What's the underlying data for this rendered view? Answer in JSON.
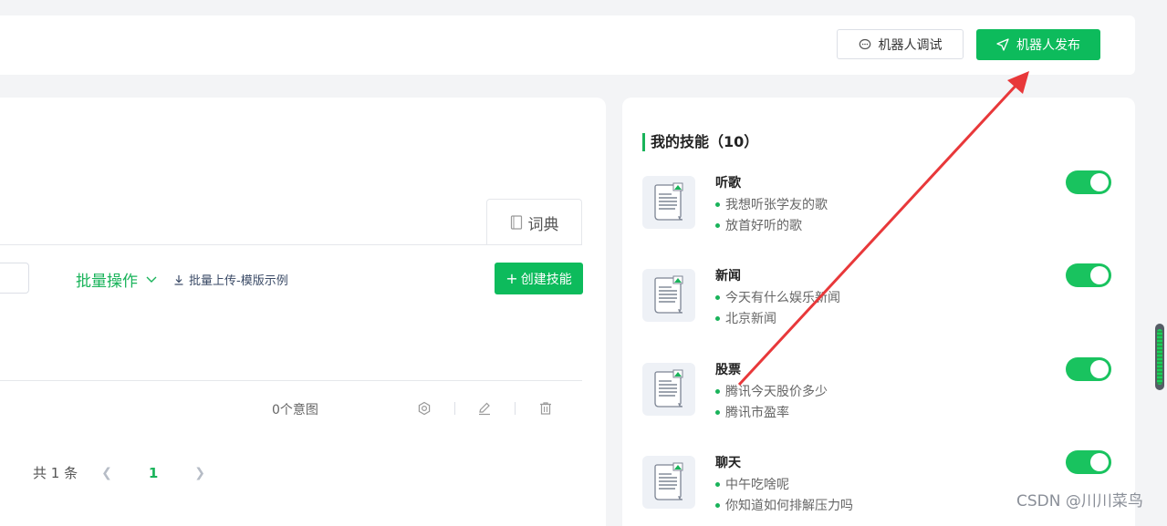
{
  "header": {
    "debug_button": "机器人调试",
    "publish_button": "机器人发布"
  },
  "workspace": {
    "dict_tab": "词典",
    "batch_operation": "批量操作",
    "batch_upload": "批量上传-模版示例",
    "create_skill": "创建技能",
    "intent_count": "0个意图",
    "pagination": {
      "total_label": "共 1 条",
      "current_page": "1"
    }
  },
  "skills": {
    "title": "我的技能（10）",
    "items": [
      {
        "name": "听歌",
        "examples": [
          "我想听张学友的歌",
          "放首好听的歌"
        ],
        "enabled": true
      },
      {
        "name": "新闻",
        "examples": [
          "今天有什么娱乐新闻",
          "北京新闻"
        ],
        "enabled": true
      },
      {
        "name": "股票",
        "examples": [
          "腾讯今天股价多少",
          "腾讯市盈率"
        ],
        "enabled": true
      },
      {
        "name": "聊天",
        "examples": [
          "中午吃啥呢",
          "你知道如何排解压力吗"
        ],
        "enabled": true
      }
    ]
  },
  "watermark": "CSDN @川川菜鸟",
  "colors": {
    "accent": "#0dbb5c",
    "annotation_arrow": "#e8383a"
  }
}
